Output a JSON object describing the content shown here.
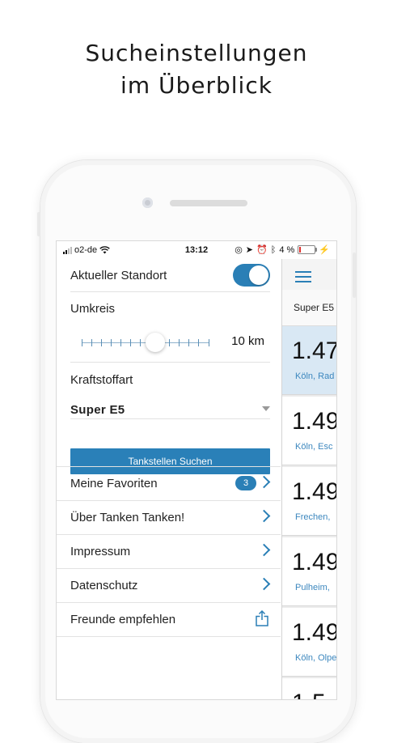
{
  "headline": {
    "line1": "Sucheinstellungen",
    "line2": "im Überblick"
  },
  "status_bar": {
    "carrier": "o2-de",
    "time": "13:12",
    "battery": "4 %"
  },
  "settings": {
    "location_label": "Aktueller Standort",
    "location_enabled": true,
    "radius_label": "Umkreis",
    "radius_value": "10 km",
    "radius_level_fraction": 0.5,
    "fuel_label": "Kraftstoffart",
    "fuel_value": "Super E5",
    "search_button": "Tankstellen Suchen"
  },
  "menu": {
    "favorites": {
      "label": "Meine Favoriten",
      "count": "3"
    },
    "about": {
      "label": "Über Tanken Tanken!"
    },
    "imprint": {
      "label": "Impressum"
    },
    "privacy": {
      "label": "Datenschutz"
    },
    "recommend": {
      "label": "Freunde empfehlen"
    }
  },
  "overlay": {
    "fuel_tab": "Super E5",
    "stations": [
      {
        "price": "1.47",
        "location": "Köln, Rad"
      },
      {
        "price": "1.49",
        "location": "Köln, Esc"
      },
      {
        "price": "1.49",
        "location": "Frechen,"
      },
      {
        "price": "1.49",
        "location": "Pulheim,"
      },
      {
        "price": "1.49",
        "location": "Köln, Olpe"
      },
      {
        "price": "1.5",
        "location": ""
      }
    ]
  },
  "colors": {
    "accent": "#2a7fb6",
    "selected_row": "#d9e8f4"
  }
}
